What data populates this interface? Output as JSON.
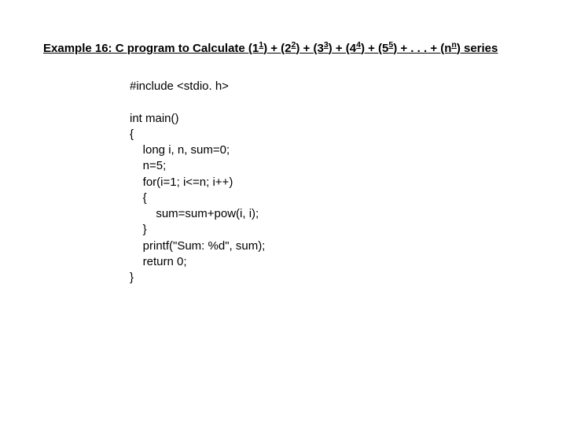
{
  "title": {
    "prefix": "Example 16: C program to Calculate (1",
    "sup1": "1",
    "p2": ") + (2",
    "sup2": "2",
    "p3": ") + (3",
    "sup3": "3",
    "p4": ") + (4",
    "sup4": "4",
    "p5": ") + (5",
    "sup5": "5",
    "p6": ") + . . . + (n",
    "supn": "n",
    "p7": ") series"
  },
  "code": {
    "l1": "#include <stdio. h>",
    "l2": "",
    "l3": "int main()",
    "l4": "{",
    "l5": "    long i, n, sum=0;",
    "l6": "    n=5;",
    "l7": "    for(i=1; i<=n; i++)",
    "l8": "    {",
    "l9": "        sum=sum+pow(i, i);",
    "l10": "    }",
    "l11": "    printf(\"Sum: %d\", sum);",
    "l12": "    return 0;",
    "l13": "}"
  }
}
